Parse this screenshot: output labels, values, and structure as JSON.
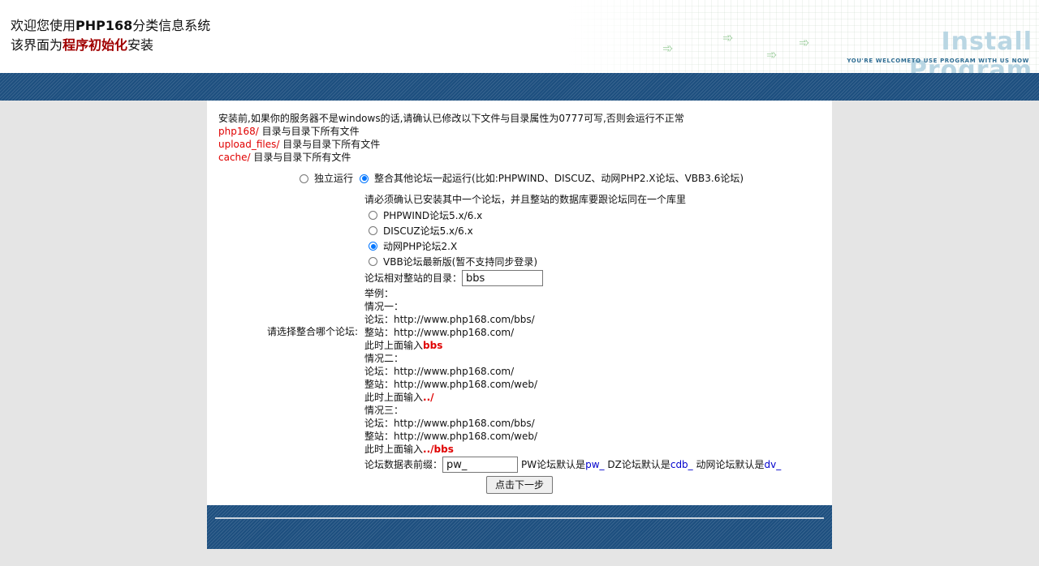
{
  "header": {
    "welcome_prefix": "欢迎您使用",
    "app_name": "PHP168",
    "welcome_suffix": "分类信息系统",
    "line2_prefix": "该界面为",
    "line2_highlight": "程序初始化",
    "line2_suffix": "安装",
    "logo_title": "Install Program",
    "logo_subtitle": "YOU'RE WELCOMETO USE PROGRAM  WITH US  NOW",
    "arrow_icon": "➾"
  },
  "notice": {
    "text": "安装前,如果你的服务器不是windows的话,请确认已修改以下文件与目录属性为0777可写,否则会运行不正常",
    "paths": [
      {
        "path": "php168/",
        "desc": " 目录与目录下所有文件"
      },
      {
        "path": "upload_files/",
        "desc": " 目录与目录下所有文件"
      },
      {
        "path": "cache/",
        "desc": " 目录与目录下所有文件"
      }
    ]
  },
  "mode": {
    "standalone": "独立运行",
    "integrated": "整合其他论坛一起运行(比如:PHPWIND、DISCUZ、动网PHP2.X论坛、VBB3.6论坛)",
    "selected": "integrated"
  },
  "forum": {
    "label": "请选择整合哪个论坛:",
    "instruction": "请必须确认已安装其中一个论坛，并且整站的数据库要跟论坛同在一个库里",
    "options": [
      "PHPWIND论坛5.x/6.x",
      "DISCUZ论坛5.x/6.x",
      "动网PHP论坛2.X",
      "VBB论坛最新版(暂不支持同步登录)"
    ],
    "selected_index": 2,
    "dir_label": "论坛相对整站的目录：",
    "dir_value": "bbs",
    "example_title": "举例：",
    "cases": [
      {
        "title": "情况一：",
        "forum": "论坛：http://www.php168.com/bbs/",
        "site": "整站：http://www.php168.com/",
        "input_prefix": "此时上面输入",
        "input_value": "bbs"
      },
      {
        "title": "情况二：",
        "forum": "论坛：http://www.php168.com/",
        "site": "整站：http://www.php168.com/web/",
        "input_prefix": "此时上面输入",
        "input_value": "../"
      },
      {
        "title": "情况三：",
        "forum": "论坛：http://www.php168.com/bbs/",
        "site": "整站：http://www.php168.com/web/",
        "input_prefix": "此时上面输入",
        "input_value": "../bbs"
      }
    ],
    "prefix_label": "论坛数据表前缀：",
    "prefix_value": "pw_",
    "pw_default_label": "PW论坛默认是",
    "pw_default": "pw_",
    "dz_default_label": " DZ论坛默认是",
    "dz_default": "cdb_",
    "dv_default_label": " 动网论坛默认是",
    "dv_default": "dv_"
  },
  "submit_label": "点击下一步",
  "colors": {
    "band_blue": "#1d4f7f",
    "path_red": "#e00000",
    "title_red": "#a00000",
    "link_blue": "#0000cc"
  }
}
